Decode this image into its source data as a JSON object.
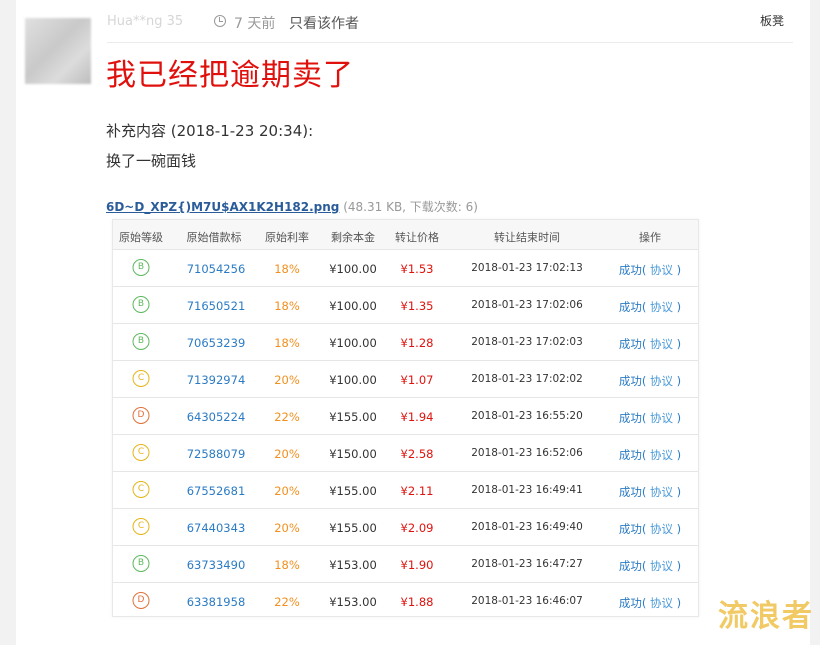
{
  "post": {
    "author": "Hua**ng 35",
    "time": "7 天前",
    "only_author": "只看该作者",
    "section_tag": "板凳",
    "title": "我已经把逾期卖了",
    "supplement_label": "补充内容 (2018-1-23 20:34):",
    "supplement_body": "换了一碗面钱",
    "attachment_name": "6D~D_XPZ{)M7U$AX1K2H182.png",
    "attachment_meta": " (48.31 KB, 下载次数: 6)"
  },
  "table": {
    "headers": [
      "原始等级",
      "原始借款标",
      "原始利率",
      "剩余本金",
      "转让价格",
      "转让结束时间",
      "操作"
    ],
    "rows": [
      {
        "grade": "B",
        "grade_color": "#5cb85c",
        "loan_id": "71054256",
        "rate": "18%",
        "principal": "¥100.00",
        "price": "¥1.53",
        "end_time": "2018-01-23 17:02:13",
        "status": "成功",
        "agreement": "协议"
      },
      {
        "grade": "B",
        "grade_color": "#5cb85c",
        "loan_id": "71650521",
        "rate": "18%",
        "principal": "¥100.00",
        "price": "¥1.35",
        "end_time": "2018-01-23 17:02:06",
        "status": "成功",
        "agreement": "协议"
      },
      {
        "grade": "B",
        "grade_color": "#5cb85c",
        "loan_id": "70653239",
        "rate": "18%",
        "principal": "¥100.00",
        "price": "¥1.28",
        "end_time": "2018-01-23 17:02:03",
        "status": "成功",
        "agreement": "协议"
      },
      {
        "grade": "C",
        "grade_color": "#e6b417",
        "loan_id": "71392974",
        "rate": "20%",
        "principal": "¥100.00",
        "price": "¥1.07",
        "end_time": "2018-01-23 17:02:02",
        "status": "成功",
        "agreement": "协议"
      },
      {
        "grade": "D",
        "grade_color": "#e0703a",
        "loan_id": "64305224",
        "rate": "22%",
        "principal": "¥155.00",
        "price": "¥1.94",
        "end_time": "2018-01-23 16:55:20",
        "status": "成功",
        "agreement": "协议"
      },
      {
        "grade": "C",
        "grade_color": "#e6b417",
        "loan_id": "72588079",
        "rate": "20%",
        "principal": "¥150.00",
        "price": "¥2.58",
        "end_time": "2018-01-23 16:52:06",
        "status": "成功",
        "agreement": "协议"
      },
      {
        "grade": "C",
        "grade_color": "#e6b417",
        "loan_id": "67552681",
        "rate": "20%",
        "principal": "¥155.00",
        "price": "¥2.11",
        "end_time": "2018-01-23 16:49:41",
        "status": "成功",
        "agreement": "协议"
      },
      {
        "grade": "C",
        "grade_color": "#e6b417",
        "loan_id": "67440343",
        "rate": "20%",
        "principal": "¥155.00",
        "price": "¥2.09",
        "end_time": "2018-01-23 16:49:40",
        "status": "成功",
        "agreement": "协议"
      },
      {
        "grade": "B",
        "grade_color": "#5cb85c",
        "loan_id": "63733490",
        "rate": "18%",
        "principal": "¥153.00",
        "price": "¥1.90",
        "end_time": "2018-01-23 16:47:27",
        "status": "成功",
        "agreement": "协议"
      },
      {
        "grade": "D",
        "grade_color": "#e0703a",
        "loan_id": "63381958",
        "rate": "22%",
        "principal": "¥153.00",
        "price": "¥1.88",
        "end_time": "2018-01-23 16:46:07",
        "status": "成功",
        "agreement": "协议"
      }
    ]
  },
  "watermark": "流浪者",
  "colors": {
    "title_red": "#e0100d",
    "link_blue": "#2b7bc4",
    "rate_orange": "#f0901e",
    "price_red": "#e0120d"
  }
}
